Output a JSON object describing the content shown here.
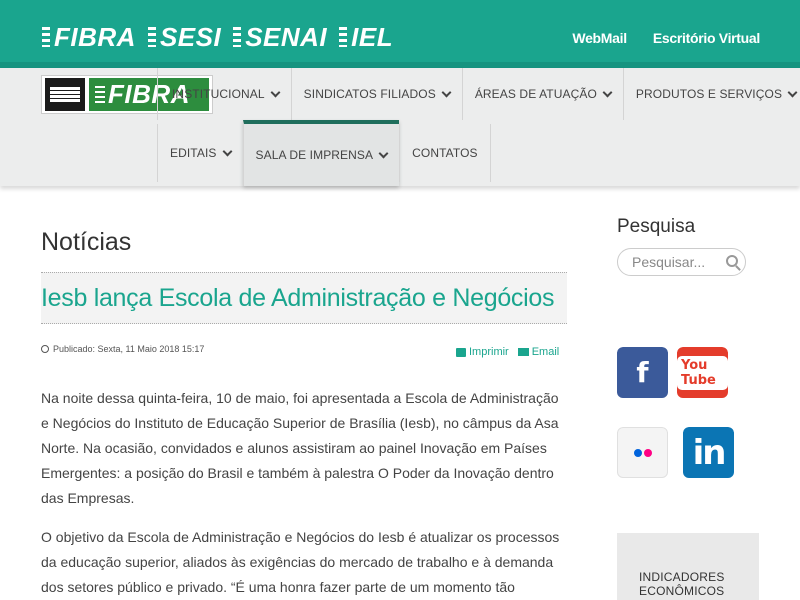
{
  "top": {
    "brands": [
      "FIBRA",
      "SESI",
      "SENAI",
      "IEL"
    ],
    "links": [
      "WebMail",
      "Escritório Virtual"
    ]
  },
  "logo": {
    "text": "FIBRA"
  },
  "nav": {
    "row1": [
      "Institucional",
      "Sindicatos Filiados",
      "Áreas de Atuação",
      "Produtos e Serviços"
    ],
    "row2": [
      "Editais",
      "Sala de Imprensa",
      "Contatos"
    ]
  },
  "main": {
    "section_title": "Notícias",
    "article_title": "Iesb lança Escola de Administração e Negócios",
    "published": "Publicado: Sexta, 11 Maio 2018 15:17",
    "print_label": "Imprimir",
    "email_label": "Email",
    "paragraphs": [
      "Na noite dessa quinta-feira, 10 de maio, foi apresentada a Escola de Administração e Negócios do Instituto de Educação Superior de Brasília (Iesb), no câmpus da Asa Norte. Na ocasião, convidados e alunos assistiram ao painel Inovação em Países Emergentes: a posição do Brasil e também à palestra O Poder da Inovação dentro das Empresas.",
      "O objetivo da Escola de Administração e Negócios do Iesb é atualizar os processos da educação superior, aliados às exigências do mercado de trabalho e à demanda dos setores público e privado. “É uma honra fazer parte de um momento tão"
    ]
  },
  "sidebar": {
    "search_title": "Pesquisa",
    "search_placeholder": "Pesquisar...",
    "social": {
      "facebook": "f",
      "youtube": "You Tube",
      "linkedin": "in"
    },
    "indicators_label": "INDICADORES ECONÔMICOS"
  },
  "colors": {
    "brand_teal": "#1aa58e",
    "facebook": "#3b5a9a",
    "youtube": "#e43c2b",
    "linkedin": "#0b75b4",
    "flickr_blue": "#0063dc",
    "flickr_pink": "#ff0084"
  }
}
